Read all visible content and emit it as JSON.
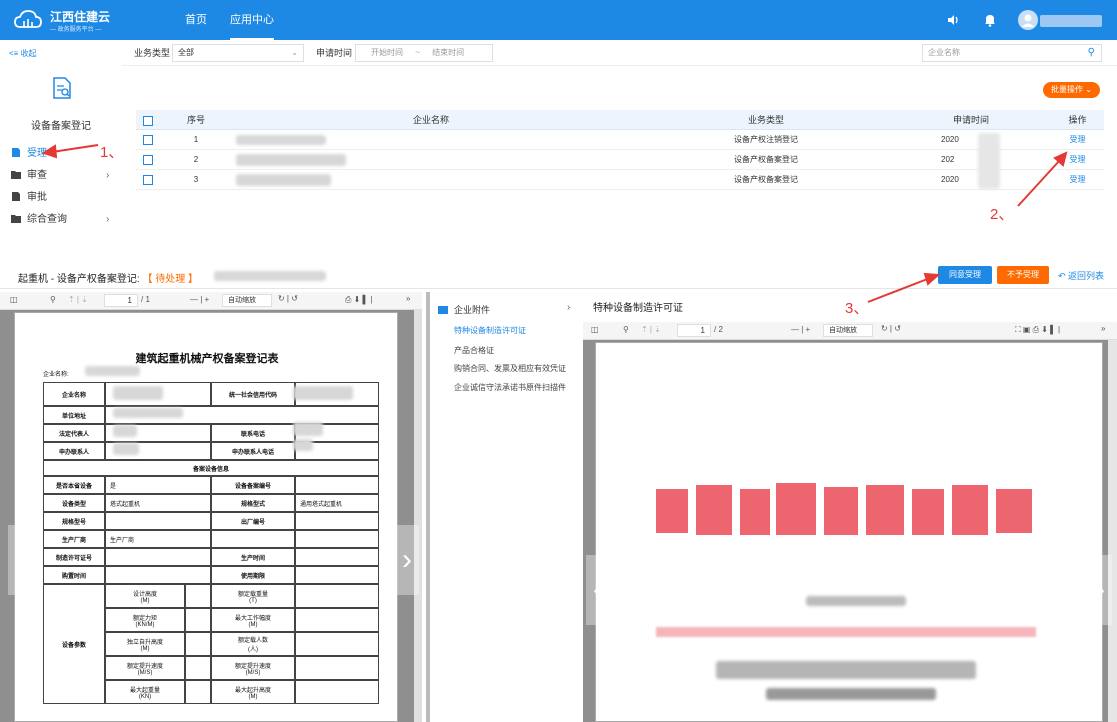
{
  "header": {
    "brand": "江西住建云",
    "brand_sub": "— 政务服务平台 —",
    "nav": [
      "首页",
      "应用中心"
    ]
  },
  "sidebar": {
    "collapse": "收起",
    "module_title": "设备备案登记",
    "items": [
      {
        "label": "受理",
        "active": true
      },
      {
        "label": "审查"
      },
      {
        "label": "审批"
      },
      {
        "label": "综合查询"
      }
    ]
  },
  "filters": {
    "biz_type_label": "业务类型",
    "biz_type_value": "全部",
    "apply_time_label": "申请时间",
    "start_placeholder": "开始时间",
    "range_sep": "~",
    "end_placeholder": "结束时间",
    "company_placeholder": "企业名称"
  },
  "bulk_button": "批量操作",
  "table": {
    "headers": [
      "序号",
      "企业名称",
      "业务类型",
      "申请时间",
      "操作"
    ],
    "rows": [
      {
        "no": "1",
        "type": "设备产权注销登记",
        "time": "2020",
        "action": "受理"
      },
      {
        "no": "2",
        "type": "设备产权备案登记",
        "time": "202",
        "action": "受理"
      },
      {
        "no": "3",
        "type": "设备产权备案登记",
        "time": "2020",
        "action": "受理"
      }
    ]
  },
  "annotations": [
    "1、",
    "2、",
    "3、"
  ],
  "detail": {
    "title": "起重机 - 设备产权备案登记:",
    "status": "【 待处理 】",
    "accept_button": "同意受理",
    "reject_button": "不予受理",
    "back_link": "返回列表"
  },
  "left_viewer": {
    "page_input": "1",
    "page_total": "/ 1",
    "zoom": "自动缩放"
  },
  "form": {
    "title": "建筑起重机械产权备案登记表",
    "company_label": "企业名称:",
    "rows1": [
      {
        "l": "企业名称",
        "r": "统一社会信用代码"
      },
      {
        "l": "单位地址"
      },
      {
        "l": "法定代表人",
        "r": "联系电话"
      },
      {
        "l": "申办联系人",
        "r": "申办联系人电话"
      }
    ],
    "section": "备案设备信息",
    "rows2": [
      {
        "l": "是否本省设备",
        "lv": "是",
        "r": "设备备案编号",
        "rv": ""
      },
      {
        "l": "设备类型",
        "lv": "塔式起重机",
        "r": "规格型式",
        "rv": "通用塔式起重机"
      },
      {
        "l": "规格型号",
        "lv": "",
        "r": "出厂编号",
        "rv": ""
      },
      {
        "l": "生产厂商",
        "lv": "生产厂商",
        "r": "",
        "rv": ""
      },
      {
        "l": "制造许可证号",
        "lv": "",
        "r": "生产时间",
        "rv": ""
      },
      {
        "l": "购置时间",
        "lv": "",
        "r": "使用期限",
        "rv": ""
      }
    ],
    "param_label": "设备参数",
    "params": [
      {
        "a": "设计高度",
        "au": "(M)",
        "b": "额定载重量",
        "bu": "(T)"
      },
      {
        "a": "额定力矩",
        "au": "(KN/M)",
        "b": "最大工作幅度",
        "bu": "(M)"
      },
      {
        "a": "独立自升高度",
        "au": "(M)",
        "b": "额定载人数",
        "bu": "(人)"
      },
      {
        "a": "额定提升速度",
        "au": "(M/S)",
        "b": "额定提升速度",
        "bu": "(M/S)"
      },
      {
        "a": "最大起重量",
        "au": "(KN)",
        "b": "最大起升高度",
        "bu": "(M)"
      }
    ]
  },
  "attachments": {
    "group": "企业附件",
    "items": [
      "特种设备制造许可证",
      "产品合格证",
      "购销合同、发票及相应有效凭证",
      "企业诚信守法承诺书原件扫描件"
    ]
  },
  "right_viewer": {
    "title": "特种设备制造许可证",
    "page_input": "1",
    "page_total": "/ 2",
    "zoom": "自动缩放"
  },
  "colors": {
    "primary": "#1e88e5",
    "accent": "#ff6a00",
    "annotation": "#e53935"
  }
}
